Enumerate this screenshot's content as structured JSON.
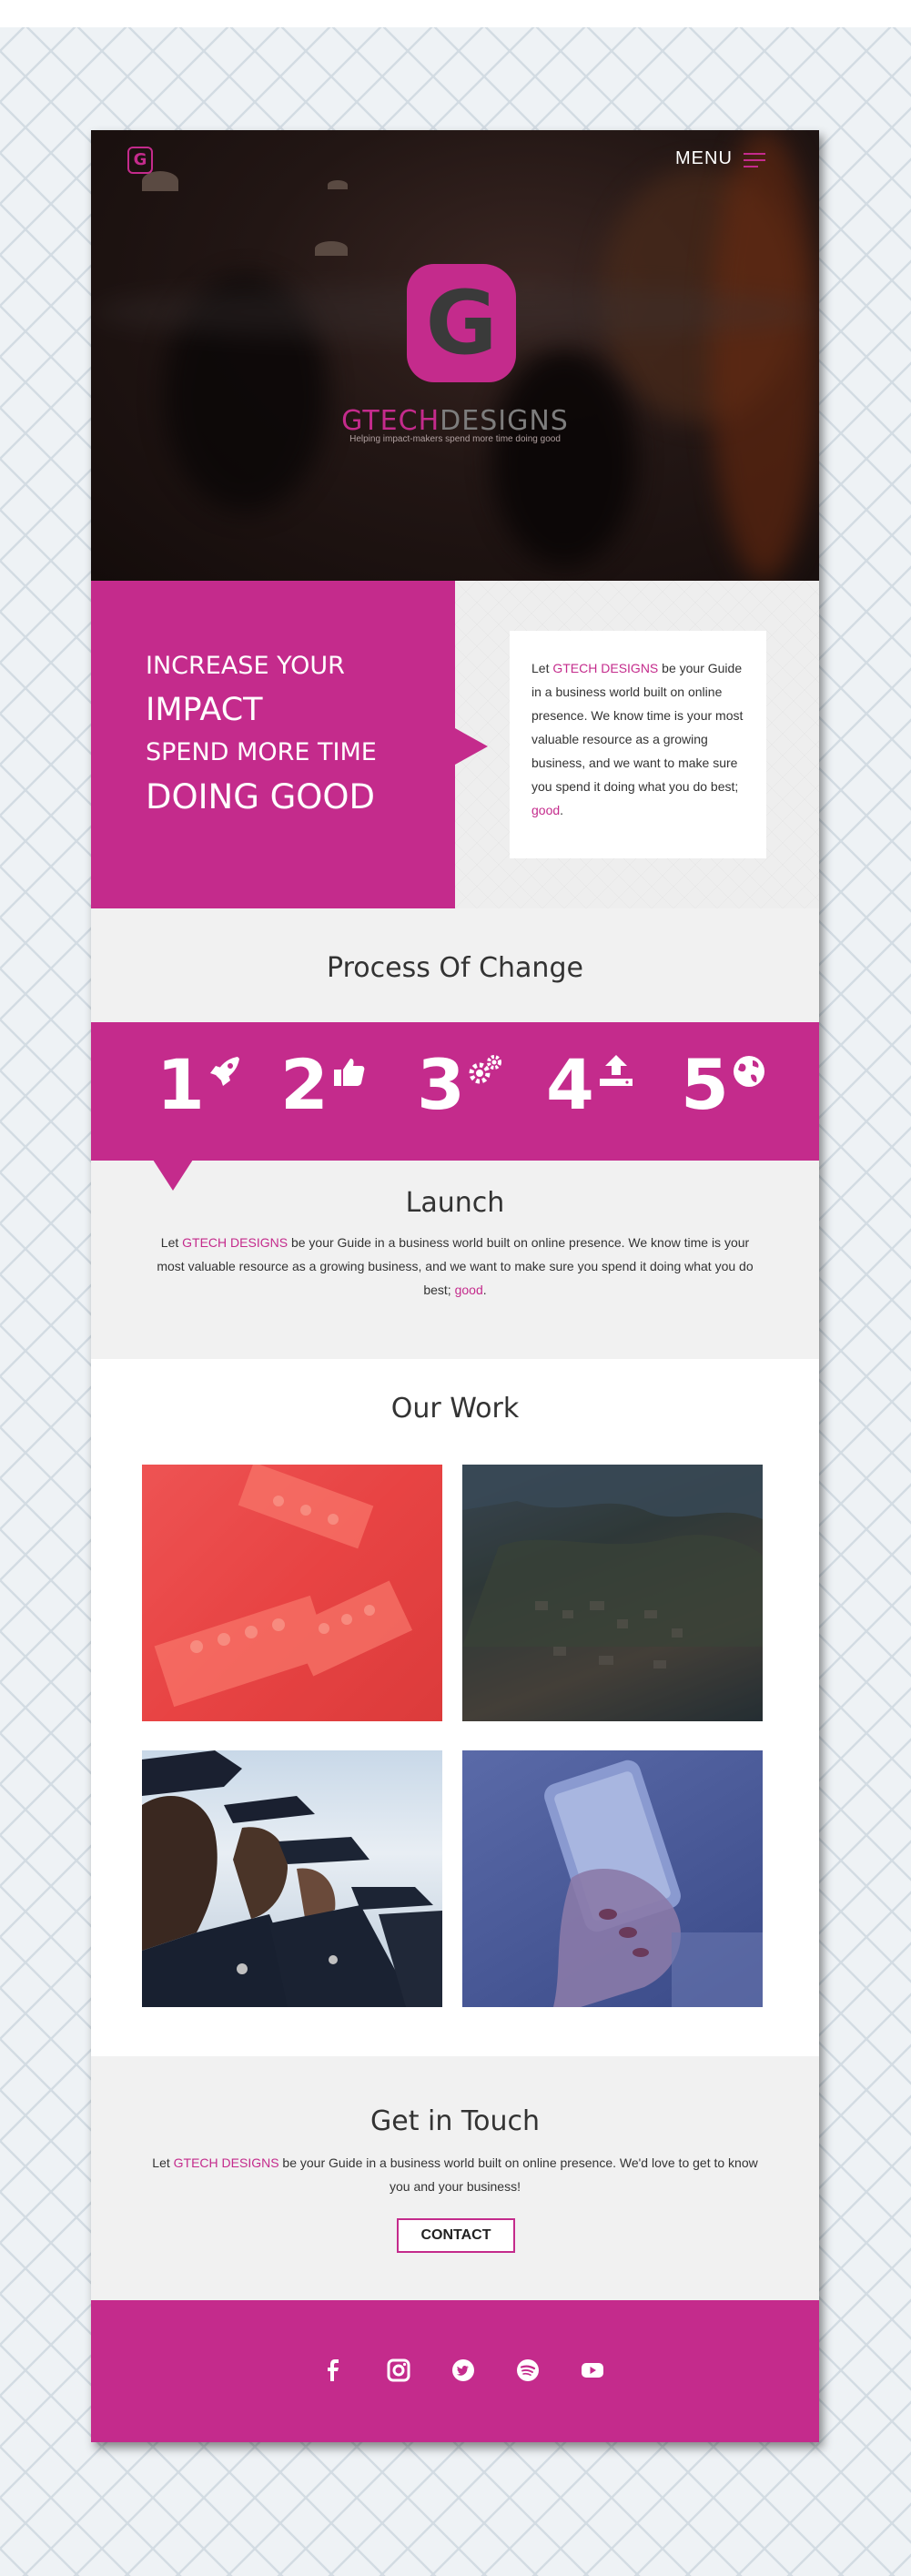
{
  "header": {
    "logo_letter": "G",
    "menu_label": "MENU",
    "brand_part1": "GTECH",
    "brand_part2": "DESIGNS",
    "tagline": "Helping impact-makers spend more time doing good",
    "brand_color": "#c42b8c"
  },
  "intro": {
    "headline_line1": "INCREASE YOUR",
    "headline_line2": "IMPACT",
    "headline_line3": "SPEND MORE TIME",
    "headline_line4": "DOING GOOD",
    "card_pre": "Let ",
    "card_brand": "GTECH DESIGNS",
    "card_mid": " be your Guide in a business world built on online presence. We know time is your most valuable resource as a growing business, and we want to make sure you spend it doing what you do best; ",
    "card_link": "good",
    "card_post": "."
  },
  "process": {
    "title": "Process Of Change",
    "steps": [
      {
        "number": "1",
        "icon": "rocket-icon"
      },
      {
        "number": "2",
        "icon": "thumbs-up-icon"
      },
      {
        "number": "3",
        "icon": "gears-icon"
      },
      {
        "number": "4",
        "icon": "upload-icon"
      },
      {
        "number": "5",
        "icon": "globe-icon"
      }
    ],
    "active_title": "Launch",
    "active_pre": "Let ",
    "active_brand": "GTECH DESIGNS",
    "active_mid": " be your Guide in a business world built on online presence. We know time is your most valuable resource as a growing business, and we want to make sure you spend it doing what you do best; ",
    "active_link": "good",
    "active_post": "."
  },
  "work": {
    "title": "Our Work",
    "items": [
      {
        "name": "lego-bricks-image"
      },
      {
        "name": "aerial-coast-image"
      },
      {
        "name": "officers-image"
      },
      {
        "name": "phone-hand-image"
      }
    ]
  },
  "contact": {
    "title": "Get in Touch",
    "pre": "Let ",
    "brand": "GTECH DESIGNS",
    "rest": " be your Guide in a business world built on online presence. We'd love to get to know you and your business!",
    "button": "CONTACT"
  },
  "footer": {
    "social": [
      "facebook-icon",
      "instagram-icon",
      "twitter-icon",
      "spotify-icon",
      "youtube-icon"
    ]
  }
}
